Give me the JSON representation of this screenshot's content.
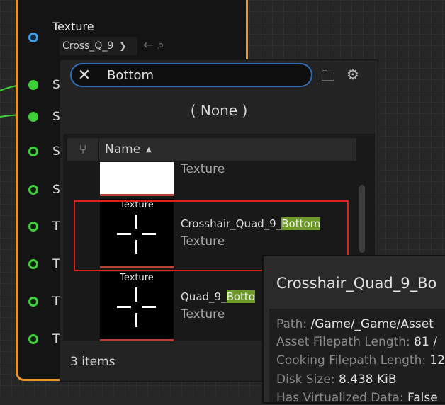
{
  "node": {
    "texture_label": "Texture",
    "texture_value": "Cross_Q_9",
    "pins": [
      {
        "label": "S",
        "style": "green-filled"
      },
      {
        "label": "S",
        "style": "green-filled"
      },
      {
        "label": "S",
        "style": "green-hollow"
      },
      {
        "label": "S",
        "style": "green-hollow"
      },
      {
        "label": "T",
        "style": "green-hollow"
      },
      {
        "label": "T",
        "style": "green-hollow"
      },
      {
        "label": "T",
        "style": "green-hollow"
      },
      {
        "label": "T",
        "style": "green-hollow"
      }
    ]
  },
  "picker": {
    "search_value": "Bottom",
    "none_label": "( None )",
    "column_name": "Name",
    "items": [
      {
        "type_label": "Texture"
      },
      {
        "thumb_label": "Texture",
        "name_prefix": "Crosshair_Quad_9_",
        "name_match": "Bottom",
        "type_label": "Texture"
      },
      {
        "thumb_label": "Texture",
        "name_prefix": "Quad_9_",
        "name_match": "Botto",
        "type_label": "Texture"
      }
    ],
    "count_label": "3 items"
  },
  "tooltip": {
    "title": "Crosshair_Quad_9_Bo",
    "rows": [
      {
        "key": "Path:",
        "value": "/Game/_Game/Asset"
      },
      {
        "key": "Asset Filepath Length:",
        "value": "81 /"
      },
      {
        "key": "Cooking Filepath Length:",
        "value": "12"
      },
      {
        "key": "Disk Size:",
        "value": "8.438 KiB"
      },
      {
        "key": "Has Virtualized Data:",
        "value": "False"
      }
    ]
  },
  "colors": {
    "node_border": "#e8962a",
    "search_border": "#2f6fba",
    "match_highlight": "#6c9a24",
    "selection_box": "#e0201a"
  }
}
